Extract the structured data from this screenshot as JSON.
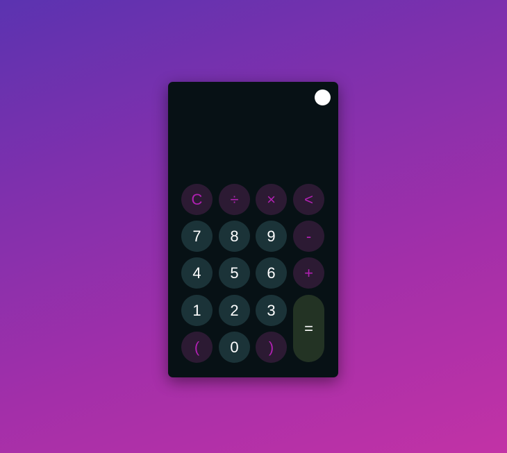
{
  "calculator": {
    "display": {
      "expression": "",
      "result": ""
    },
    "keys": {
      "clear": "C",
      "divide": "÷",
      "multiply": "×",
      "backspace": "<",
      "seven": "7",
      "eight": "8",
      "nine": "9",
      "subtract": "-",
      "four": "4",
      "five": "5",
      "six": "6",
      "add": "+",
      "one": "1",
      "two": "2",
      "three": "3",
      "equals": "=",
      "open_paren": "(",
      "zero": "0",
      "close_paren": ")"
    },
    "colors": {
      "body": "#071115",
      "operator_bg": "#2c1a33",
      "operator_text": "#b021b2",
      "number_bg": "#1b3338",
      "number_text": "#ffffff",
      "equals_bg": "#233324",
      "toggle": "#ffffff"
    }
  }
}
